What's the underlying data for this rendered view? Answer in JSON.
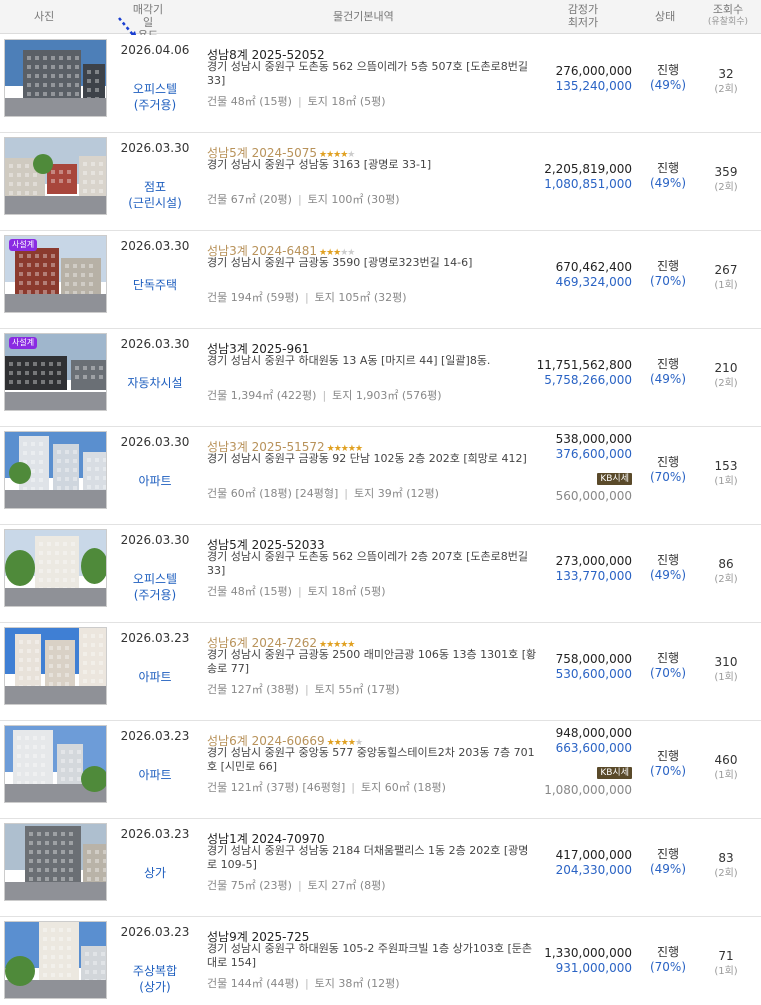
{
  "header": {
    "photo": "사진",
    "deadline_line1": "매각기일",
    "deadline_line2": "용도",
    "basic": "물건기본내역",
    "price_line1": "감정가",
    "price_line2": "최저가",
    "status": "상태",
    "views_line1": "조회수",
    "views_line2": "(유찰회수)"
  },
  "rows": [
    {
      "date": "2026.04.06",
      "use1": "오피스텔",
      "use2": "(주거용)",
      "case": "성남8계 2025-52052",
      "stars": 0,
      "addr": "경기 성남시 중원구 도촌동 562 으뜸이레가 5층 507호 [도촌로8번길 33]",
      "building": "건물 48㎡ (15평)",
      "land": "토지 18㎡ (5평)",
      "appraisal": "276,000,000",
      "minimum": "135,240,000",
      "status": "진행",
      "pct": "(49%)",
      "views": "32",
      "fail": "(2회)"
    },
    {
      "date": "2026.03.30",
      "use1": "점포",
      "use2": "(근린시설)",
      "case": "성남5계 2024-5075",
      "stars": 4,
      "addr": "경기 성남시 중원구 성남동 3163 [광명로 33-1]",
      "building": "건물 67㎡ (20평)",
      "land": "토지 100㎡ (30평)",
      "appraisal": "2,205,819,000",
      "minimum": "1,080,851,000",
      "status": "진행",
      "pct": "(49%)",
      "views": "359",
      "fail": "(2회)"
    },
    {
      "date": "2026.03.30",
      "use1": "단독주택",
      "use2": "",
      "case": "성남3계 2024-6481",
      "stars": 3,
      "addr": "경기 성남시 중원구 금광동 3590 [광명로323번길 14-6]",
      "building": "건물 194㎡ (59평)",
      "land": "토지 105㎡ (32평)",
      "appraisal": "670,462,400",
      "minimum": "469,324,000",
      "status": "진행",
      "pct": "(70%)",
      "views": "267",
      "fail": "(1회)",
      "badge": "사설계"
    },
    {
      "date": "2026.03.30",
      "use1": "자동차시설",
      "use2": "",
      "case": "성남3계 2025-961",
      "stars": 0,
      "addr": "경기 성남시 중원구 하대원동 13 A동 [마지르 44] [일괄]8동.",
      "building": "건물 1,394㎡ (422평)",
      "land": "토지 1,903㎡ (576평)",
      "appraisal": "11,751,562,800",
      "minimum": "5,758,266,000",
      "status": "진행",
      "pct": "(49%)",
      "views": "210",
      "fail": "(2회)",
      "badge": "사설계"
    },
    {
      "date": "2026.03.30",
      "use1": "아파트",
      "use2": "",
      "case": "성남3계 2025-51572",
      "stars": 5,
      "addr": "경기 성남시 중원구 금광동 92 단남 102동 2층 202호 [희망로 412]",
      "building": "건물 60㎡ (18평) [24평형]",
      "land": "토지 39㎡ (12평)",
      "appraisal": "538,000,000",
      "minimum": "376,600,000",
      "status": "진행",
      "pct": "(70%)",
      "views": "153",
      "fail": "(1회)",
      "kb_label": "KB시세",
      "kb_price": "560,000,000"
    },
    {
      "date": "2026.03.30",
      "use1": "오피스텔",
      "use2": "(주거용)",
      "case": "성남5계 2025-52033",
      "stars": 0,
      "addr": "경기 성남시 중원구 도촌동 562 으뜸이레가 2층 207호 [도촌로8번길 33]",
      "building": "건물 48㎡ (15평)",
      "land": "토지 18㎡ (5평)",
      "appraisal": "273,000,000",
      "minimum": "133,770,000",
      "status": "진행",
      "pct": "(49%)",
      "views": "86",
      "fail": "(2회)"
    },
    {
      "date": "2026.03.23",
      "use1": "아파트",
      "use2": "",
      "case": "성남6계 2024-7262",
      "stars": 5,
      "addr": "경기 성남시 중원구 금광동 2500 래미안금광 106동 13층 1301호 [황송로 77]",
      "building": "건물 127㎡ (38평)",
      "land": "토지 55㎡ (17평)",
      "appraisal": "758,000,000",
      "minimum": "530,600,000",
      "status": "진행",
      "pct": "(70%)",
      "views": "310",
      "fail": "(1회)"
    },
    {
      "date": "2026.03.23",
      "use1": "아파트",
      "use2": "",
      "case": "성남6계 2024-60669",
      "stars": 4,
      "addr": "경기 성남시 중원구 중앙동 577 중앙동힐스테이트2차 203동 7층 701호 [시민로 66]",
      "building": "건물 121㎡ (37평) [46평형]",
      "land": "토지 60㎡ (18평)",
      "appraisal": "948,000,000",
      "minimum": "663,600,000",
      "status": "진행",
      "pct": "(70%)",
      "views": "460",
      "fail": "(1회)",
      "kb_label": "KB시세",
      "kb_price": "1,080,000,000"
    },
    {
      "date": "2026.03.23",
      "use1": "상가",
      "use2": "",
      "case": "성남1계 2024-70970",
      "stars": 0,
      "addr": "경기 성남시 중원구 성남동 2184 더채움팰리스 1동 2층 202호 [광명로 109-5]",
      "building": "건물 75㎡ (23평)",
      "land": "토지 27㎡ (8평)",
      "appraisal": "417,000,000",
      "minimum": "204,330,000",
      "status": "진행",
      "pct": "(49%)",
      "views": "83",
      "fail": "(2회)"
    },
    {
      "date": "2026.03.23",
      "use1": "주상복합",
      "use2": "(상가)",
      "case": "성남9계 2025-725",
      "stars": 0,
      "addr": "경기 성남시 중원구 하대원동 105-2 주원파크빌 1층 상가103호 [둔촌대로 154]",
      "building": "건물 144㎡ (44평)",
      "land": "토지 38㎡ (12평)",
      "appraisal": "1,330,000,000",
      "minimum": "931,000,000",
      "status": "진행",
      "pct": "(70%)",
      "views": "71",
      "fail": "(1회)"
    }
  ],
  "colors": {
    "link_blue": "#2a63c4",
    "gold_case": "#b8925a",
    "star": "#e0a020",
    "badge": "#8a2be2"
  }
}
